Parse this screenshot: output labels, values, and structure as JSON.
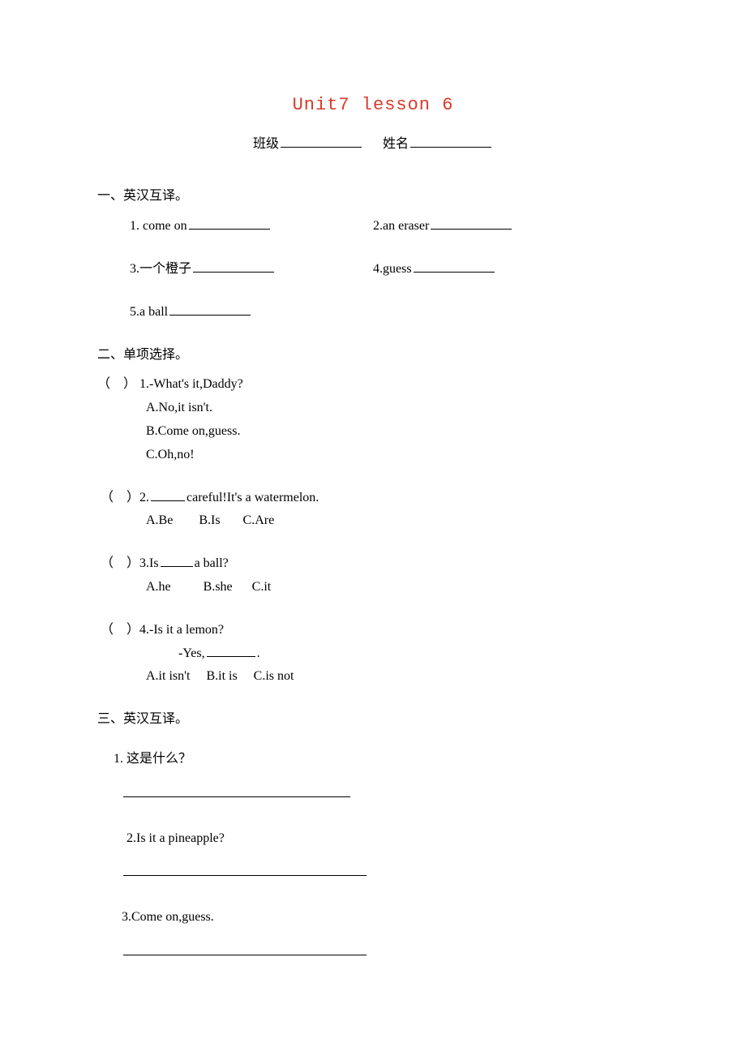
{
  "title": "Unit7 lesson 6",
  "header": {
    "class_label": "班级",
    "name_label": "姓名"
  },
  "section1": {
    "heading": "一、英汉互译。",
    "items": [
      {
        "num": "1.",
        "text": "come on"
      },
      {
        "num": "2.",
        "text": "an eraser"
      },
      {
        "num": "3.",
        "text": "一个橙子"
      },
      {
        "num": "4.",
        "text": "guess"
      },
      {
        "num": "5.",
        "text": "a ball"
      }
    ]
  },
  "section2": {
    "heading": "二、单项选择。",
    "questions": [
      {
        "num": "1.",
        "stem": "-What's it,Daddy?",
        "options": [
          "A.No,it isn't.",
          "B.Come on,guess.",
          "C.Oh,no!"
        ]
      },
      {
        "num": "2.",
        "stem_pre": "",
        "stem_post": "careful!It's a watermelon.",
        "options_line": "A.Be        B.Is       C.Are"
      },
      {
        "num": "3.",
        "stem_pre": "Is",
        "stem_post": "a ball?",
        "options_line": "A.he          B.she      C.it"
      },
      {
        "num": "4.",
        "stem": "-Is it a lemon?",
        "stem2_pre": "-Yes,",
        "stem2_post": ".",
        "options_line": "A.it isn't     B.it is     C.is not"
      }
    ]
  },
  "section3": {
    "heading": "三、英汉互译。",
    "items": [
      {
        "num": "1.",
        "text": "这是什么？"
      },
      {
        "num": "2.",
        "text": "Is it a pineapple?"
      },
      {
        "num": "3.",
        "text": "Come on,guess."
      }
    ]
  }
}
